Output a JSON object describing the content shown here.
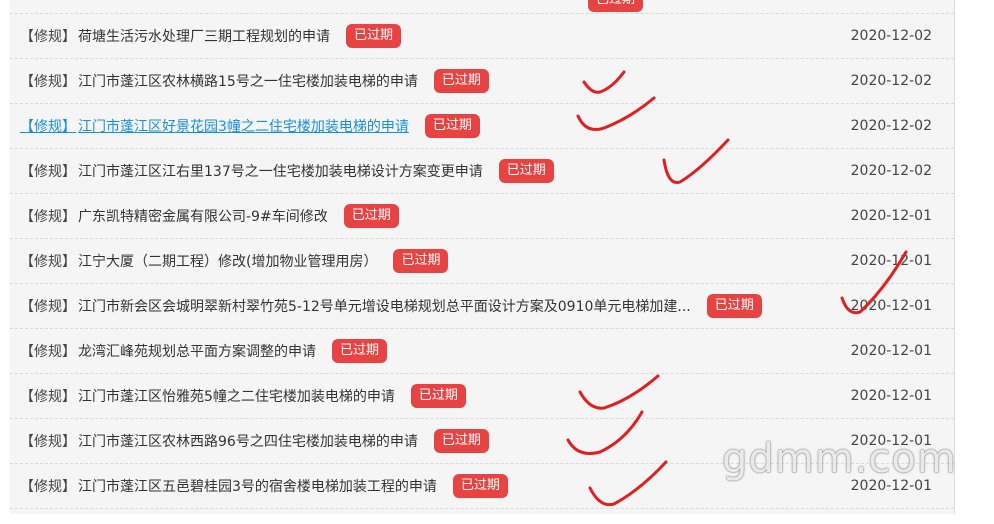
{
  "colors": {
    "badge": "#e84343",
    "link_active": "#1a8fd8",
    "check_marks": "#e02020"
  },
  "list": {
    "rows": [
      {
        "prefix": "",
        "title": "",
        "badge": "已过期",
        "date": ""
      },
      {
        "prefix": "【修规】",
        "title": "荷塘生活污水处理厂三期工程规划的申请",
        "badge": "已过期",
        "date": "2020-12-02"
      },
      {
        "prefix": "【修规】",
        "title": "江门市蓬江区农林横路15号之一住宅楼加装电梯的申请",
        "badge": "已过期",
        "date": "2020-12-02"
      },
      {
        "prefix": "【修规】",
        "title": "江门市蓬江区好景花园3幢之二住宅楼加装电梯的申请",
        "badge": "已过期",
        "date": "2020-12-02"
      },
      {
        "prefix": "【修规】",
        "title": "江门市蓬江区江右里137号之一住宅楼加装电梯设计方案变更申请",
        "badge": "已过期",
        "date": "2020-12-02"
      },
      {
        "prefix": "【修规】",
        "title": "广东凯特精密金属有限公司-9#车间修改",
        "badge": "已过期",
        "date": "2020-12-01"
      },
      {
        "prefix": "【修规】",
        "title": "江宁大厦（二期工程）修改(增加物业管理用房）",
        "badge": "已过期",
        "date": "2020-12-01"
      },
      {
        "prefix": "【修规】",
        "title": "江门市新会区会城明翠新村翠竹苑5-12号单元增设电梯规划总平面设计方案及0910单元电梯加建...",
        "badge": "已过期",
        "date": "2020-12-01"
      },
      {
        "prefix": "【修规】",
        "title": "龙湾汇峰苑规划总平面方案调整的申请",
        "badge": "已过期",
        "date": "2020-12-01"
      },
      {
        "prefix": "【修规】",
        "title": "江门市蓬江区怡雅苑5幢之二住宅楼加装电梯的申请",
        "badge": "已过期",
        "date": "2020-12-01"
      },
      {
        "prefix": "【修规】",
        "title": "江门市蓬江区农林西路96号之四住宅楼加装电梯的申请",
        "badge": "已过期",
        "date": "2020-12-01"
      },
      {
        "prefix": "【修规】",
        "title": "江门市蓬江区五邑碧桂园3号的宿舍楼电梯加装工程的申请",
        "badge": "已过期",
        "date": "2020-12-01"
      }
    ]
  },
  "watermark": "gdmm.com"
}
